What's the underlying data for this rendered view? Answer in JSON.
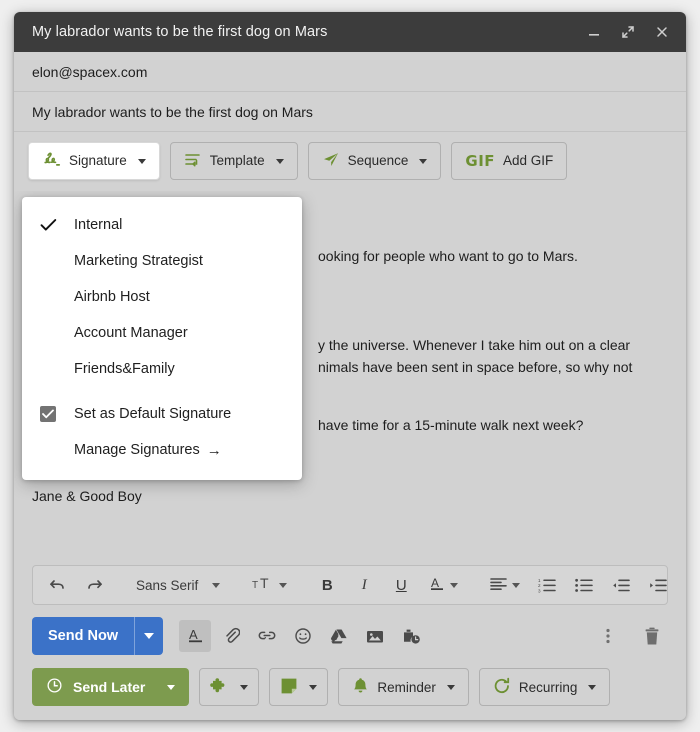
{
  "window": {
    "title": "My labrador wants to be the first dog on Mars",
    "controls": {
      "minimize": "minimize-icon",
      "expand": "expand-icon",
      "close": "close-icon"
    }
  },
  "compose": {
    "recipient": "elon@spacex.com",
    "subject": "My labrador wants to be the first dog on Mars",
    "body_lines": [
      "ooking for people who want to go to Mars.",
      "y the universe. Whenever I take him out on a clear",
      "nimals have been sent in space before, so why not",
      "have time for a 15-minute walk next week?"
    ],
    "closing": "Jane & Good Boy"
  },
  "feature_toolbar": {
    "buttons": [
      {
        "label": "Signature",
        "icon": "signature-icon",
        "has_caret": true,
        "active": true
      },
      {
        "label": "Template",
        "icon": "template-icon",
        "has_caret": true,
        "active": false
      },
      {
        "label": "Sequence",
        "icon": "sequence-icon",
        "has_caret": true,
        "active": false
      },
      {
        "label": "Add GIF",
        "icon": "gif-icon",
        "gif_mark": "GIF",
        "has_caret": false,
        "active": false
      }
    ]
  },
  "signature_menu": {
    "signatures": [
      {
        "label": "Internal",
        "checked": true
      },
      {
        "label": "Marketing Strategist",
        "checked": false
      },
      {
        "label": "Airbnb Host",
        "checked": false
      },
      {
        "label": "Account Manager",
        "checked": false
      },
      {
        "label": "Friends&Family",
        "checked": false
      }
    ],
    "default_option": {
      "label": "Set as Default Signature",
      "checked": true
    },
    "manage": {
      "label": "Manage Signatures",
      "arrow": "→"
    }
  },
  "format_toolbar": {
    "undo": "undo-icon",
    "redo": "redo-icon",
    "font_family": "Sans Serif",
    "font_size": "font-size-icon",
    "bold": "B",
    "italic": "I",
    "underline": "U",
    "text_color": "A",
    "align": "align-icon",
    "numbered_list": "numbered-list-icon",
    "bullet_list": "bullet-list-icon",
    "indent_decrease": "indent-decrease-icon",
    "indent_increase": "indent-increase-icon",
    "more": "more-format-icon"
  },
  "send_row": {
    "send_now": "Send Now",
    "icons": [
      "format-text-icon",
      "attachment-icon",
      "link-icon",
      "emoji-icon",
      "google-drive-icon",
      "insert-image-icon",
      "schedule-send-icon"
    ],
    "more_options": "more-options-icon",
    "discard": "trash-icon"
  },
  "bottom_row": {
    "send_later": {
      "label": "Send Later",
      "icon": "clock-icon",
      "has_caret": true
    },
    "buttons": [
      {
        "label": "",
        "icon": "puzzle-icon",
        "has_caret": true
      },
      {
        "label": "",
        "icon": "note-icon",
        "has_caret": true
      },
      {
        "label": "Reminder",
        "icon": "bell-icon",
        "has_caret": true
      },
      {
        "label": "Recurring",
        "icon": "recurring-icon",
        "has_caret": true
      }
    ]
  },
  "colors": {
    "accent_green": "#7d9b4e",
    "icon_green": "#6d9033",
    "send_blue": "#3b72c8",
    "titlebar": "#3c3c3c",
    "surface": "#d2d2d2"
  }
}
